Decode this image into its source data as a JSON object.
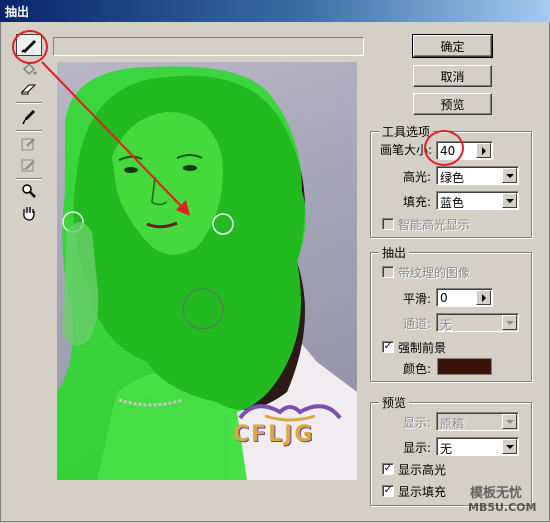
{
  "window": {
    "title": "抽出"
  },
  "buttons": {
    "ok": "确定",
    "cancel": "取消",
    "preview": "预览"
  },
  "tool_options": {
    "group_label": "工具选项",
    "brush_size_label": "画笔大小:",
    "brush_size_value": "40",
    "highlight_label": "高光:",
    "highlight_value": "绿色",
    "fill_label": "填充:",
    "fill_value": "蓝色",
    "smart_highlight_label": "智能高光显示",
    "smart_highlight_checked": false
  },
  "extraction": {
    "group_label": "抽出",
    "textured_label": "带纹理的图像",
    "textured_checked": false,
    "smooth_label": "平滑:",
    "smooth_value": "0",
    "channel_label": "通道:",
    "channel_value": "无",
    "force_fg_label": "强制前景",
    "force_fg_checked": true,
    "color_label": "颜色:",
    "color_value": "#3a1208"
  },
  "preview_group": {
    "group_label": "预览",
    "show_label": "显示:",
    "show_value": "原稿",
    "display_label": "显示:",
    "display_value": "无",
    "show_highlight_label": "显示高光",
    "show_highlight_checked": true,
    "show_fill_label": "显示填充",
    "show_fill_checked": true
  },
  "tools": [
    {
      "name": "edge-highlighter-tool",
      "active": true
    },
    {
      "name": "fill-tool",
      "active": false
    },
    {
      "name": "eraser-tool",
      "active": false
    },
    {
      "name": "eyedropper-tool",
      "active": false
    },
    {
      "name": "cleanup-tool",
      "active": false
    },
    {
      "name": "edge-touchup-tool",
      "active": false
    },
    {
      "name": "zoom-tool",
      "active": false
    },
    {
      "name": "hand-tool",
      "active": false
    }
  ],
  "watermarks": {
    "logo": "CFLJG",
    "site_cn": "模板无忧",
    "site": "MB5U.COM"
  },
  "colors": {
    "highlight": "#22dd22",
    "titlebar": "#0a246a",
    "annotation": "#e02020"
  }
}
